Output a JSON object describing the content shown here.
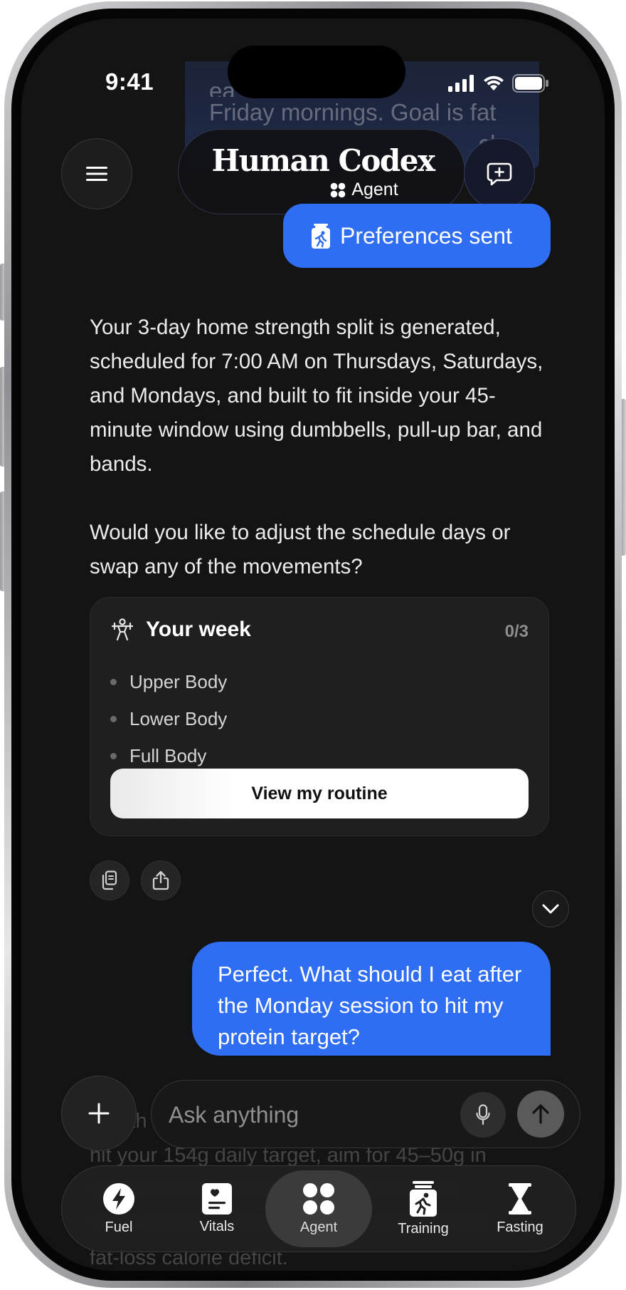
{
  "status": {
    "time": "9:41"
  },
  "previous_message": {
    "lines": [
      "ea",
      "Friday mornings. Goal is fat",
      "cle."
    ]
  },
  "header": {
    "brand": "Human Codex",
    "subtitle": "Agent"
  },
  "preferences_pill": {
    "label": "Preferences sent"
  },
  "assistant": {
    "paragraph1": "Your 3-day home strength split is generated, scheduled for 7:00 AM on Thursdays, Saturdays, and Mondays, and built to fit inside your 45-minute window using dumbbells, pull-up bar, and bands.",
    "paragraph2": "Would you like to adjust the schedule days or swap any of the movements?"
  },
  "week_card": {
    "title": "Your week",
    "count": "0/3",
    "items": [
      "Upper Body",
      "Lower Body",
      "Full Body"
    ],
    "button_label": "View my routine"
  },
  "user_message": "Perfect. What should I eat after the Monday session to hit my protein target?",
  "faded_response": {
    "line1": "ith",
    "line2": "hit your 154g daily target, aim for 45–50g in",
    "line5": "fat-loss calorie deficit."
  },
  "composer": {
    "placeholder": "Ask anything"
  },
  "tabs": [
    {
      "label": "Fuel",
      "icon": "bolt-icon"
    },
    {
      "label": "Vitals",
      "icon": "vitals-icon"
    },
    {
      "label": "Agent",
      "icon": "agent-grid-icon",
      "active": true
    },
    {
      "label": "Training",
      "icon": "training-icon"
    },
    {
      "label": "Fasting",
      "icon": "hourglass-icon"
    }
  ],
  "colors": {
    "accent_blue": "#2f6ef2",
    "background": "#141414",
    "card": "#1f1f1f"
  }
}
